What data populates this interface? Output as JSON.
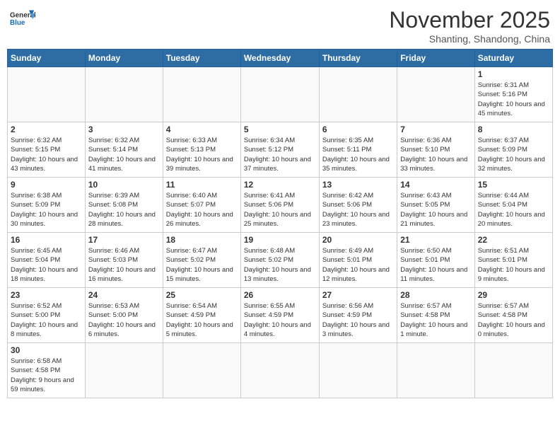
{
  "header": {
    "logo_general": "General",
    "logo_blue": "Blue",
    "month_title": "November 2025",
    "location": "Shanting, Shandong, China"
  },
  "days_of_week": [
    "Sunday",
    "Monday",
    "Tuesday",
    "Wednesday",
    "Thursday",
    "Friday",
    "Saturday"
  ],
  "weeks": [
    [
      {
        "day": "",
        "info": ""
      },
      {
        "day": "",
        "info": ""
      },
      {
        "day": "",
        "info": ""
      },
      {
        "day": "",
        "info": ""
      },
      {
        "day": "",
        "info": ""
      },
      {
        "day": "",
        "info": ""
      },
      {
        "day": "1",
        "info": "Sunrise: 6:31 AM\nSunset: 5:16 PM\nDaylight: 10 hours and 45 minutes."
      }
    ],
    [
      {
        "day": "2",
        "info": "Sunrise: 6:32 AM\nSunset: 5:15 PM\nDaylight: 10 hours and 43 minutes."
      },
      {
        "day": "3",
        "info": "Sunrise: 6:32 AM\nSunset: 5:14 PM\nDaylight: 10 hours and 41 minutes."
      },
      {
        "day": "4",
        "info": "Sunrise: 6:33 AM\nSunset: 5:13 PM\nDaylight: 10 hours and 39 minutes."
      },
      {
        "day": "5",
        "info": "Sunrise: 6:34 AM\nSunset: 5:12 PM\nDaylight: 10 hours and 37 minutes."
      },
      {
        "day": "6",
        "info": "Sunrise: 6:35 AM\nSunset: 5:11 PM\nDaylight: 10 hours and 35 minutes."
      },
      {
        "day": "7",
        "info": "Sunrise: 6:36 AM\nSunset: 5:10 PM\nDaylight: 10 hours and 33 minutes."
      },
      {
        "day": "8",
        "info": "Sunrise: 6:37 AM\nSunset: 5:09 PM\nDaylight: 10 hours and 32 minutes."
      }
    ],
    [
      {
        "day": "9",
        "info": "Sunrise: 6:38 AM\nSunset: 5:09 PM\nDaylight: 10 hours and 30 minutes."
      },
      {
        "day": "10",
        "info": "Sunrise: 6:39 AM\nSunset: 5:08 PM\nDaylight: 10 hours and 28 minutes."
      },
      {
        "day": "11",
        "info": "Sunrise: 6:40 AM\nSunset: 5:07 PM\nDaylight: 10 hours and 26 minutes."
      },
      {
        "day": "12",
        "info": "Sunrise: 6:41 AM\nSunset: 5:06 PM\nDaylight: 10 hours and 25 minutes."
      },
      {
        "day": "13",
        "info": "Sunrise: 6:42 AM\nSunset: 5:06 PM\nDaylight: 10 hours and 23 minutes."
      },
      {
        "day": "14",
        "info": "Sunrise: 6:43 AM\nSunset: 5:05 PM\nDaylight: 10 hours and 21 minutes."
      },
      {
        "day": "15",
        "info": "Sunrise: 6:44 AM\nSunset: 5:04 PM\nDaylight: 10 hours and 20 minutes."
      }
    ],
    [
      {
        "day": "16",
        "info": "Sunrise: 6:45 AM\nSunset: 5:04 PM\nDaylight: 10 hours and 18 minutes."
      },
      {
        "day": "17",
        "info": "Sunrise: 6:46 AM\nSunset: 5:03 PM\nDaylight: 10 hours and 16 minutes."
      },
      {
        "day": "18",
        "info": "Sunrise: 6:47 AM\nSunset: 5:02 PM\nDaylight: 10 hours and 15 minutes."
      },
      {
        "day": "19",
        "info": "Sunrise: 6:48 AM\nSunset: 5:02 PM\nDaylight: 10 hours and 13 minutes."
      },
      {
        "day": "20",
        "info": "Sunrise: 6:49 AM\nSunset: 5:01 PM\nDaylight: 10 hours and 12 minutes."
      },
      {
        "day": "21",
        "info": "Sunrise: 6:50 AM\nSunset: 5:01 PM\nDaylight: 10 hours and 11 minutes."
      },
      {
        "day": "22",
        "info": "Sunrise: 6:51 AM\nSunset: 5:01 PM\nDaylight: 10 hours and 9 minutes."
      }
    ],
    [
      {
        "day": "23",
        "info": "Sunrise: 6:52 AM\nSunset: 5:00 PM\nDaylight: 10 hours and 8 minutes."
      },
      {
        "day": "24",
        "info": "Sunrise: 6:53 AM\nSunset: 5:00 PM\nDaylight: 10 hours and 6 minutes."
      },
      {
        "day": "25",
        "info": "Sunrise: 6:54 AM\nSunset: 4:59 PM\nDaylight: 10 hours and 5 minutes."
      },
      {
        "day": "26",
        "info": "Sunrise: 6:55 AM\nSunset: 4:59 PM\nDaylight: 10 hours and 4 minutes."
      },
      {
        "day": "27",
        "info": "Sunrise: 6:56 AM\nSunset: 4:59 PM\nDaylight: 10 hours and 3 minutes."
      },
      {
        "day": "28",
        "info": "Sunrise: 6:57 AM\nSunset: 4:58 PM\nDaylight: 10 hours and 1 minute."
      },
      {
        "day": "29",
        "info": "Sunrise: 6:57 AM\nSunset: 4:58 PM\nDaylight: 10 hours and 0 minutes."
      }
    ],
    [
      {
        "day": "30",
        "info": "Sunrise: 6:58 AM\nSunset: 4:58 PM\nDaylight: 9 hours and 59 minutes."
      },
      {
        "day": "",
        "info": ""
      },
      {
        "day": "",
        "info": ""
      },
      {
        "day": "",
        "info": ""
      },
      {
        "day": "",
        "info": ""
      },
      {
        "day": "",
        "info": ""
      },
      {
        "day": "",
        "info": ""
      }
    ]
  ]
}
